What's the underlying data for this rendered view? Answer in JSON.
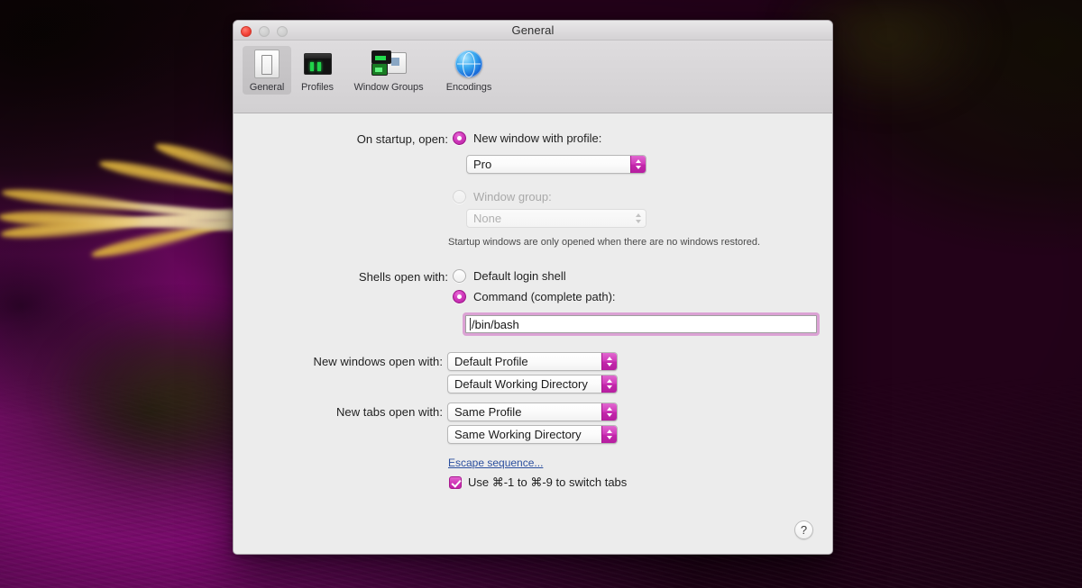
{
  "window": {
    "title": "General",
    "traffic_lights": [
      "close",
      "minimize",
      "zoom"
    ]
  },
  "toolbar": {
    "items": [
      {
        "label": "General",
        "icon": "general-window-icon",
        "selected": true
      },
      {
        "label": "Profiles",
        "icon": "terminal-profile-icon",
        "selected": false
      },
      {
        "label": "Window Groups",
        "icon": "window-groups-icon",
        "selected": false
      },
      {
        "label": "Encodings",
        "icon": "globe-icon",
        "selected": false
      }
    ]
  },
  "form": {
    "startup": {
      "label": "On startup, open:",
      "option_new_window": "New window with profile:",
      "option_new_window_selected": true,
      "profile_value": "Pro",
      "option_window_group": "Window group:",
      "option_window_group_selected": false,
      "option_window_group_disabled": true,
      "window_group_value": "None",
      "hint": "Startup windows are only opened when there are no windows restored."
    },
    "shells": {
      "label": "Shells open with:",
      "option_default_login": "Default login shell",
      "option_default_login_selected": false,
      "option_command": "Command (complete path):",
      "option_command_selected": true,
      "command_value": "/bin/bash",
      "command_placeholder": "/bin/bash"
    },
    "new_windows": {
      "label": "New windows open with:",
      "profile_value": "Default Profile",
      "directory_value": "Default Working Directory"
    },
    "new_tabs": {
      "label": "New tabs open with:",
      "profile_value": "Same Profile",
      "directory_value": "Same Working Directory"
    },
    "escape_sequence_link": "Escape sequence...",
    "switch_tabs": {
      "label": "Use ⌘-1 to ⌘-9 to switch tabs",
      "checked": true
    }
  },
  "help_button": {
    "glyph": "?"
  },
  "colors": {
    "accent": "#c33cb2",
    "accent_dark": "#a8188f",
    "link": "#2b4f9e",
    "window_bg": "#ececec",
    "toolbar_bg": "#d6d4d6",
    "close_red": "#f4453a"
  }
}
